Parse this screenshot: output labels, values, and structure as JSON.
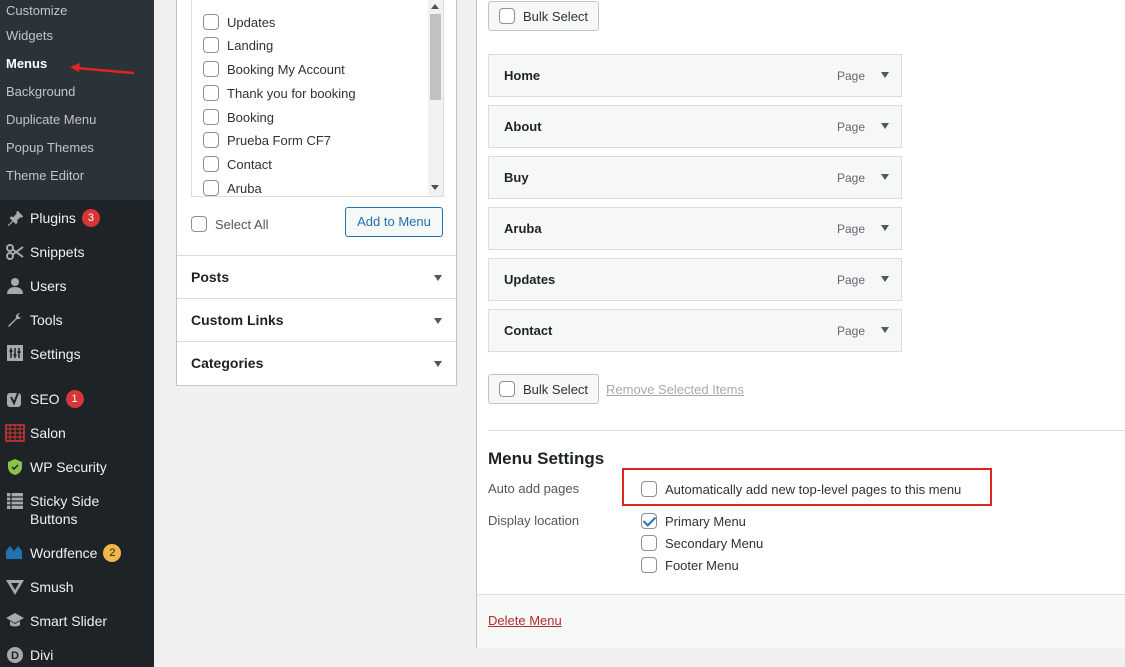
{
  "sidebar": {
    "submenu": [
      {
        "label": "Customize"
      },
      {
        "label": "Widgets"
      },
      {
        "label": "Menus"
      },
      {
        "label": "Background"
      },
      {
        "label": "Duplicate Menu"
      },
      {
        "label": "Popup Themes"
      },
      {
        "label": "Theme Editor"
      }
    ],
    "items": [
      {
        "label": "Plugins",
        "icon": "plugin-icon",
        "badge": "3"
      },
      {
        "label": "Snippets",
        "icon": "snippets-icon"
      },
      {
        "label": "Users",
        "icon": "users-icon"
      },
      {
        "label": "Tools",
        "icon": "wrench-icon"
      },
      {
        "label": "Settings",
        "icon": "settings-icon"
      },
      {
        "label": "SEO",
        "icon": "yoast-icon",
        "badge": "1"
      },
      {
        "label": "Salon",
        "icon": "calendar-icon"
      },
      {
        "label": "WP Security",
        "icon": "shield-icon"
      },
      {
        "label": "Sticky Side Buttons",
        "icon": "list-icon"
      },
      {
        "label": "Wordfence",
        "icon": "wordfence-icon",
        "badge": "2"
      },
      {
        "label": "Smush",
        "icon": "smush-icon"
      },
      {
        "label": "Smart Slider",
        "icon": "grad-cap-icon"
      },
      {
        "label": "Divi",
        "icon": "divi-icon"
      }
    ]
  },
  "pages_panel": {
    "pages": [
      {
        "label": "Updates",
        "checked": false
      },
      {
        "label": "Landing",
        "checked": false
      },
      {
        "label": "Booking My Account",
        "checked": false
      },
      {
        "label": "Thank you for booking",
        "checked": false
      },
      {
        "label": "Booking",
        "checked": false
      },
      {
        "label": "Prueba Form CF7",
        "checked": false
      },
      {
        "label": "Contact",
        "checked": false
      },
      {
        "label": "Aruba",
        "checked": false
      }
    ],
    "select_all": "Select All",
    "add_to_menu": "Add to Menu"
  },
  "accordion": [
    {
      "label": "Posts"
    },
    {
      "label": "Custom Links"
    },
    {
      "label": "Categories"
    }
  ],
  "menu_structure": {
    "bulk_select": "Bulk Select",
    "items": [
      {
        "title": "Home",
        "type": "Page"
      },
      {
        "title": "About",
        "type": "Page"
      },
      {
        "title": "Buy",
        "type": "Page"
      },
      {
        "title": "Aruba",
        "type": "Page"
      },
      {
        "title": "Updates",
        "type": "Page"
      },
      {
        "title": "Contact",
        "type": "Page"
      }
    ],
    "remove_selected": "Remove Selected Items"
  },
  "menu_settings": {
    "title": "Menu Settings",
    "auto_add_label": "Auto add pages",
    "auto_add_option": "Automatically add new top-level pages to this menu",
    "auto_add_checked": false,
    "display_location_label": "Display location",
    "locations": [
      {
        "label": "Primary Menu",
        "checked": true
      },
      {
        "label": "Secondary Menu",
        "checked": false
      },
      {
        "label": "Footer Menu",
        "checked": false
      }
    ]
  },
  "delete_menu": "Delete Menu",
  "colors": {
    "sidebar_bg": "#1d2327",
    "submenu_bg": "#2c3338",
    "accent": "#2271b1",
    "annotation": "#e02424",
    "delete": "#b32d2e"
  }
}
